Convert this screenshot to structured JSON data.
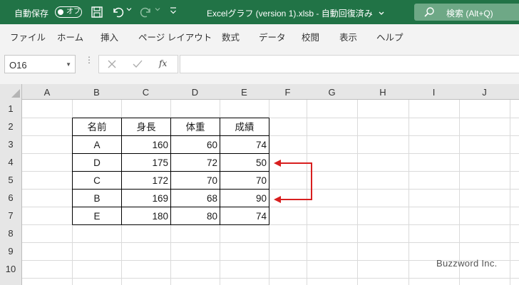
{
  "titlebar": {
    "autosave_label": "自動保存",
    "autosave_toggle": "オフ",
    "doc_title": "Excelグラフ (version 1).xlsb  -  自動回復済み",
    "search_text": "検索 (Alt+Q)"
  },
  "menu": {
    "items": [
      "ファイル",
      "ホーム",
      "挿入",
      "ページ レイアウト",
      "数式",
      "データ",
      "校閲",
      "表示",
      "ヘルプ"
    ]
  },
  "formula_bar": {
    "name_box": "O16",
    "fx_label": "fx",
    "content": ""
  },
  "sheet": {
    "columns": [
      "A",
      "B",
      "C",
      "D",
      "E",
      "F",
      "G",
      "H",
      "I",
      "J"
    ],
    "rows": [
      "1",
      "2",
      "3",
      "4",
      "5",
      "6",
      "7",
      "8",
      "9",
      "10"
    ]
  },
  "table": {
    "headers": [
      "名前",
      "身長",
      "体重",
      "成績"
    ],
    "rows": [
      [
        "A",
        "160",
        "60",
        "74"
      ],
      [
        "D",
        "175",
        "72",
        "50"
      ],
      [
        "C",
        "172",
        "70",
        "70"
      ],
      [
        "B",
        "169",
        "68",
        "90"
      ],
      [
        "E",
        "180",
        "80",
        "74"
      ]
    ]
  },
  "annotation": {
    "arrow_color": "#d81f1f",
    "connects_rows": [
      "4",
      "6"
    ]
  },
  "watermark": "Buzzword Inc.",
  "colors": {
    "titlebar": "#217346",
    "ribbon": "#f3f3f3",
    "header": "#e6e6e6"
  }
}
